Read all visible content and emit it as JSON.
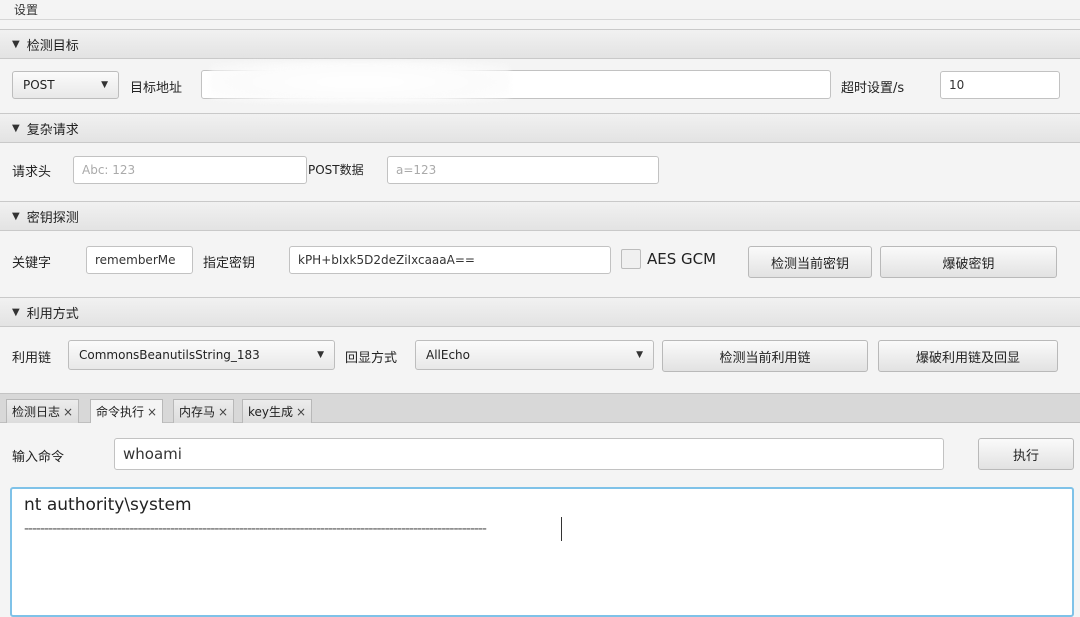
{
  "menu": {
    "settings": "设置"
  },
  "sections": {
    "target": {
      "title": "检测目标",
      "method": "POST",
      "target_label": "目标地址",
      "target_value": "",
      "timeout_label": "超时设置/s",
      "timeout_value": "10"
    },
    "complex": {
      "title": "复杂请求",
      "header_label": "请求头",
      "header_placeholder": "Abc: 123",
      "post_label": "POST数据",
      "post_placeholder": "a=123"
    },
    "key": {
      "title": "密钥探测",
      "keyword_label": "关键字",
      "keyword_value": "rememberMe",
      "key_label": "指定密钥",
      "key_value": "kPH+bIxk5D2deZiIxcaaaA==",
      "aes_gcm_label": "AES GCM",
      "detect_key_button": "检测当前密钥",
      "brute_key_button": "爆破密钥"
    },
    "exploit": {
      "title": "利用方式",
      "chain_label": "利用链",
      "chain_value": "CommonsBeanutilsString_183",
      "echo_label": "回显方式",
      "echo_value": "AllEcho",
      "detect_chain_button": "检测当前利用链",
      "brute_chain_button": "爆破利用链及回显"
    }
  },
  "tabs": [
    {
      "label": "检测日志",
      "close": "×"
    },
    {
      "label": "命令执行",
      "close": "×"
    },
    {
      "label": "内存马",
      "close": "×"
    },
    {
      "label": "key生成",
      "close": "×"
    }
  ],
  "command": {
    "label": "输入命令",
    "value": "whoami",
    "execute_button": "执行",
    "output_line1": "nt authority\\system",
    "output_line2": "------------------------------------------------------------------------------------------------------------------"
  },
  "icons": {
    "collapse": "▼",
    "dropdown": "▼"
  },
  "colors": {
    "focus_border": "#7fc2e8"
  }
}
